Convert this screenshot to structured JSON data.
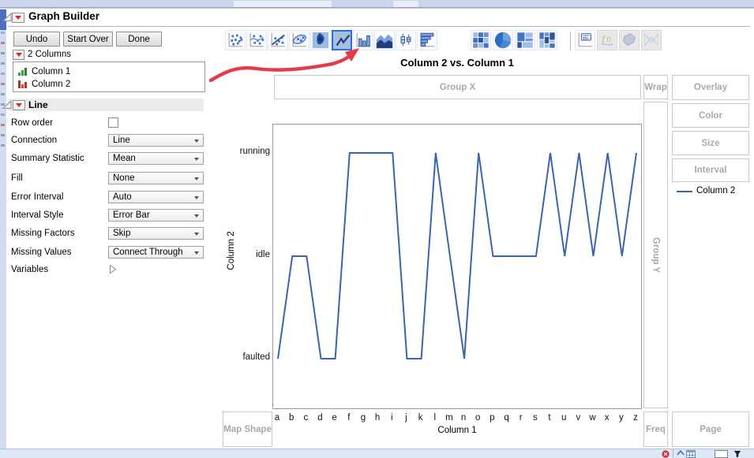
{
  "panel": {
    "title": "Graph Builder",
    "buttons": [
      "Undo",
      "Start Over",
      "Done"
    ],
    "columns_header": "2 Columns",
    "columns": [
      {
        "name": "Column 1",
        "icon": "ordinal-green-bars-icon"
      },
      {
        "name": "Column 2",
        "icon": "nominal-red-bars-icon"
      }
    ],
    "section": "Line",
    "properties": [
      {
        "label": "Row order",
        "control": "checkbox",
        "checked": false
      },
      {
        "label": "Connection",
        "control": "dropdown",
        "value": "Line"
      },
      {
        "label": "Summary Statistic",
        "control": "dropdown",
        "value": "Mean"
      },
      {
        "label": "Fill",
        "control": "dropdown",
        "value": "None"
      },
      {
        "label": "Error Interval",
        "control": "dropdown",
        "value": "Auto"
      },
      {
        "label": "Interval Style",
        "control": "dropdown",
        "value": "Error Bar"
      },
      {
        "label": "Missing Factors",
        "control": "dropdown",
        "value": "Skip"
      },
      {
        "label": "Missing Values",
        "control": "dropdown",
        "value": "Connect Through"
      },
      {
        "label": "Variables",
        "control": "disclosure"
      }
    ]
  },
  "toolbar": {
    "icons": [
      "scatter",
      "smoother",
      "line-of-fit",
      "ellipse",
      "contour",
      "line",
      "bar",
      "area",
      "box-plot",
      "histogram",
      "heatmap",
      "pie",
      "treemap",
      "mosaic",
      "caption-box",
      "formula",
      "map-shape",
      "parallel"
    ],
    "selected": "line",
    "disabled": [
      "formula",
      "map-shape",
      "parallel"
    ]
  },
  "graph": {
    "title": "Column 2 vs. Column 1",
    "zones": {
      "group_x": "Group X",
      "wrap": "Wrap",
      "overlay": "Overlay",
      "color": "Color",
      "size": "Size",
      "interval": "Interval",
      "group_y": "Group Y",
      "map_shape": "Map Shape",
      "freq": "Freq",
      "page": "Page"
    },
    "legend": {
      "label": "Column 2"
    }
  },
  "annotation": {
    "type": "hand-drawn-arrow",
    "color": "#e8394a",
    "points_to": "line chart type icon"
  },
  "statusbar": {
    "icons": [
      "alert-icon",
      "home-icon",
      "table-icon",
      "selection-box-icon",
      "filter-icon"
    ]
  },
  "colors": {
    "series_line": "#3a64ad",
    "selected_icon_border": "#2a6fd1",
    "selected_icon_bg": "#a9bfdf",
    "zone_text": "#a9a9a9",
    "chrome_strip": "#cbd4ec"
  },
  "chart_data": {
    "type": "line",
    "title": "Column 2 vs. Column 1",
    "xlabel": "Column 1",
    "ylabel": "Column 2",
    "x": [
      "a",
      "b",
      "c",
      "d",
      "e",
      "f",
      "g",
      "h",
      "i",
      "j",
      "k",
      "l",
      "m",
      "n",
      "o",
      "p",
      "q",
      "r",
      "s",
      "t",
      "u",
      "v",
      "w",
      "x",
      "y",
      "z"
    ],
    "y_categories_bottom_to_top": [
      "faulted",
      "idle",
      "running"
    ],
    "series": [
      {
        "name": "Column 2",
        "color": "#3a64ad",
        "values": [
          "faulted",
          "idle",
          "idle",
          "faulted",
          "faulted",
          "running",
          "running",
          "running",
          "running",
          "faulted",
          "faulted",
          "running",
          "idle",
          "faulted",
          "running",
          "idle",
          "idle",
          "idle",
          "idle",
          "running",
          "idle",
          "running",
          "idle",
          "running",
          "idle",
          "running"
        ]
      }
    ],
    "legend_position": "right",
    "grid": false
  }
}
